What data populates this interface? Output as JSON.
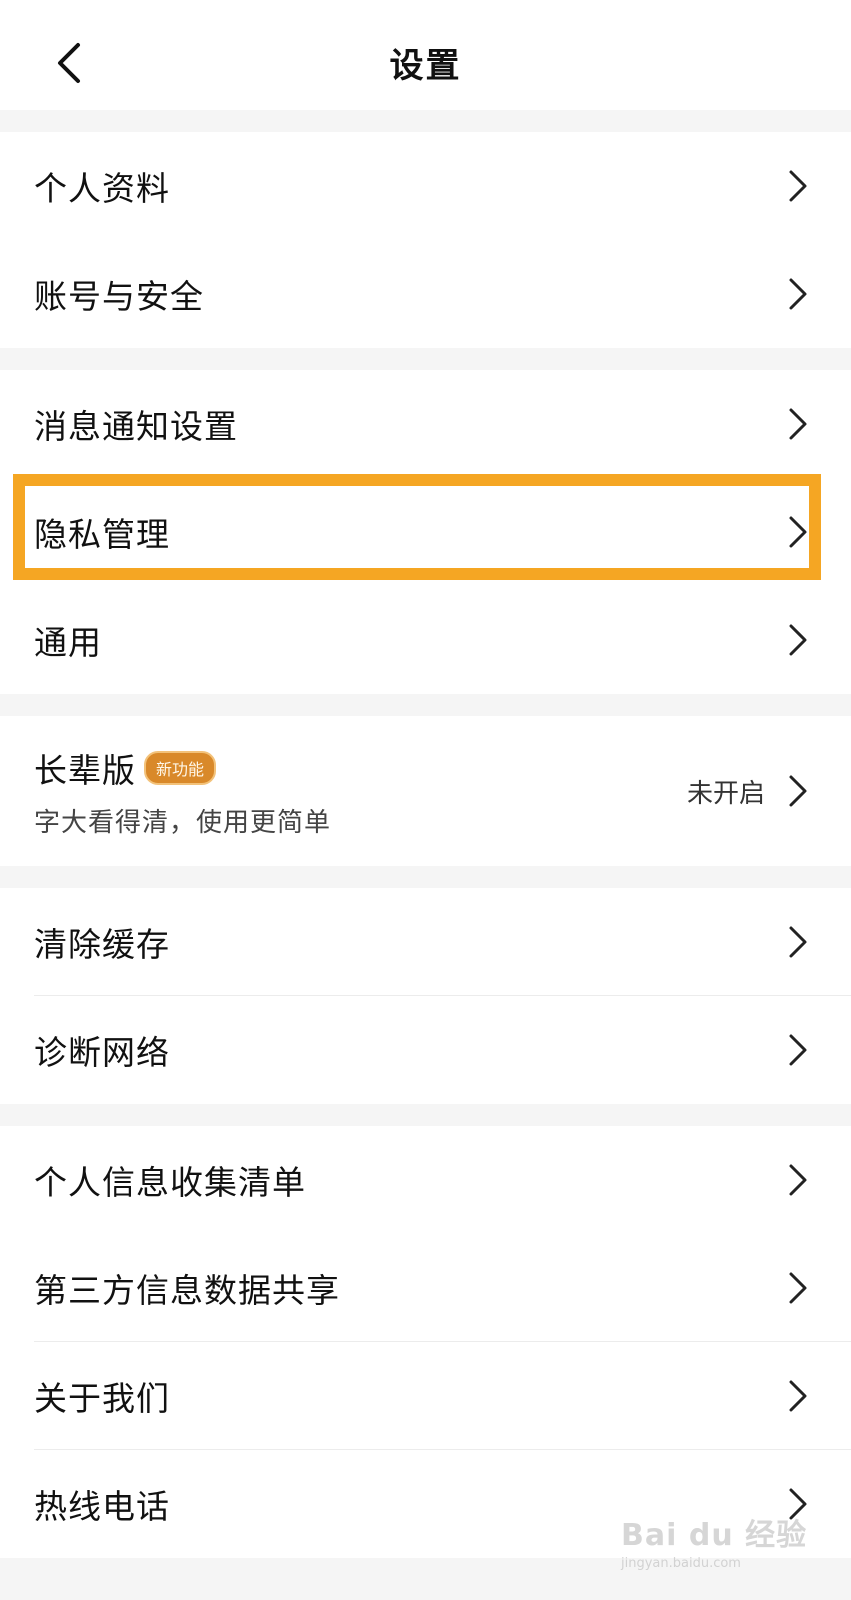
{
  "header": {
    "title": "设置"
  },
  "groups": [
    {
      "items": [
        {
          "label": "个人资料"
        },
        {
          "label": "账号与安全"
        }
      ]
    },
    {
      "items": [
        {
          "label": "消息通知设置"
        },
        {
          "label": "隐私管理"
        },
        {
          "label": "通用"
        }
      ]
    },
    {
      "elder": {
        "title": "长辈版",
        "badge": "新功能",
        "subtitle": "字大看得清，使用更简单",
        "status": "未开启"
      }
    },
    {
      "items": [
        {
          "label": "清除缓存"
        },
        {
          "label": "诊断网络"
        }
      ]
    },
    {
      "items": [
        {
          "label": "个人信息收集清单"
        },
        {
          "label": "第三方信息数据共享"
        },
        {
          "label": "关于我们"
        },
        {
          "label": "热线电话"
        }
      ]
    }
  ],
  "highlight": {
    "target": "隐私管理",
    "color": "#f5a623"
  },
  "watermark": {
    "main": "Bai du 经验",
    "sub": "jingyan.baidu.com"
  },
  "icons": {
    "back": "chevron-left-icon",
    "row": "chevron-right-icon"
  }
}
